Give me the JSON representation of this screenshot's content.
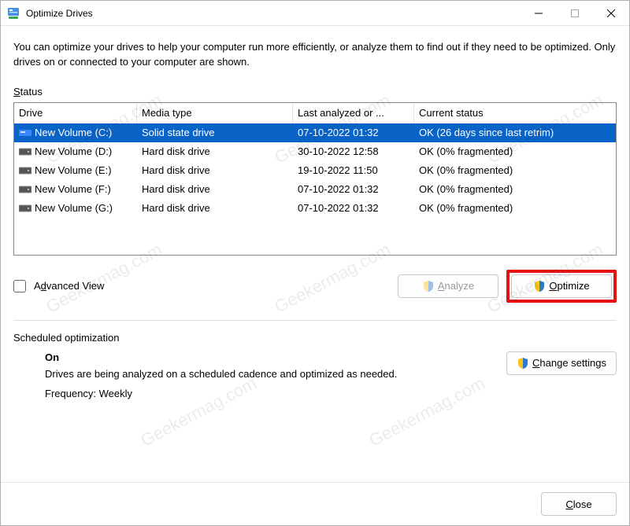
{
  "window": {
    "title": "Optimize Drives"
  },
  "intro": "You can optimize your drives to help your computer run more efficiently, or analyze them to find out if they need to be optimized. Only drives on or connected to your computer are shown.",
  "status_label_pre": "S",
  "status_label_rest": "tatus",
  "columns": {
    "drive": "Drive",
    "media": "Media type",
    "last": "Last analyzed or ...",
    "status": "Current status"
  },
  "drives": [
    {
      "name": "New Volume (C:)",
      "media": "Solid state drive",
      "last": "07-10-2022 01:32",
      "status": "OK (26 days since last retrim)",
      "selected": true,
      "icon": "ssd"
    },
    {
      "name": "New Volume (D:)",
      "media": "Hard disk drive",
      "last": "30-10-2022 12:58",
      "status": "OK (0% fragmented)",
      "selected": false,
      "icon": "hdd"
    },
    {
      "name": "New Volume (E:)",
      "media": "Hard disk drive",
      "last": "19-10-2022 11:50",
      "status": "OK (0% fragmented)",
      "selected": false,
      "icon": "hdd"
    },
    {
      "name": "New Volume (F:)",
      "media": "Hard disk drive",
      "last": "07-10-2022 01:32",
      "status": "OK (0% fragmented)",
      "selected": false,
      "icon": "hdd"
    },
    {
      "name": "New Volume (G:)",
      "media": "Hard disk drive",
      "last": "07-10-2022 01:32",
      "status": "OK (0% fragmented)",
      "selected": false,
      "icon": "hdd"
    }
  ],
  "advanced_view": {
    "pre": "A",
    "underline": "d",
    "rest": "vanced View",
    "checked": false
  },
  "buttons": {
    "analyze": {
      "pre": "",
      "underline": "A",
      "rest": "nalyze",
      "enabled": false
    },
    "optimize": {
      "pre": "",
      "underline": "O",
      "rest": "ptimize",
      "enabled": true,
      "highlighted": true
    },
    "change_settings": {
      "pre": "",
      "underline": "C",
      "rest": "hange settings"
    },
    "close": {
      "pre": "",
      "underline": "C",
      "rest": "lose"
    }
  },
  "scheduled": {
    "label": "Scheduled optimization",
    "on_label": "On",
    "desc": "Drives are being analyzed on a scheduled cadence and optimized as needed.",
    "freq_label": "Frequency: Weekly"
  },
  "watermark": "Geekermag.com"
}
